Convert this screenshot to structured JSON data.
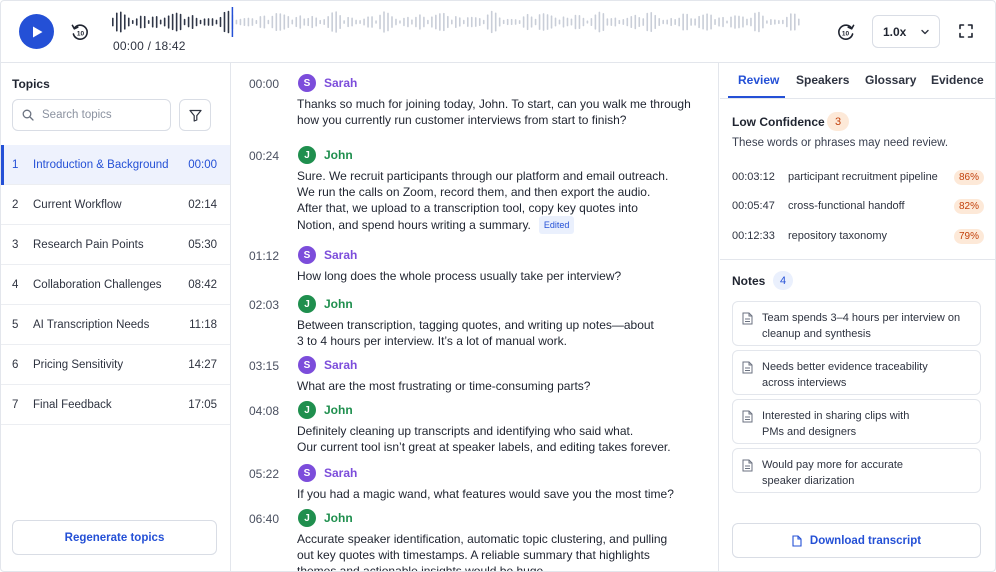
{
  "player": {
    "time_readout": "00:00 / 18:42",
    "rewind_label": "10",
    "forward_label": "10",
    "speed": "1.0x",
    "progress": 0.175,
    "colors": {
      "accent": "#2450d6",
      "wave_played": "#2f3647",
      "wave_unplayed": "#c9ced8"
    }
  },
  "topics": {
    "title": "Topics",
    "search_placeholder": "Search topics",
    "items": [
      {
        "num": "1",
        "label": "Introduction & Background",
        "time": "00:00",
        "active": true
      },
      {
        "num": "2",
        "label": "Current Workflow",
        "time": "02:14"
      },
      {
        "num": "3",
        "label": "Research Pain Points",
        "time": "05:30"
      },
      {
        "num": "4",
        "label": "Collaboration Challenges",
        "time": "08:42"
      },
      {
        "num": "5",
        "label": "AI Transcription Needs",
        "time": "11:18"
      },
      {
        "num": "6",
        "label": "Pricing Sensitivity",
        "time": "14:27"
      },
      {
        "num": "7",
        "label": "Final Feedback",
        "time": "17:05"
      }
    ],
    "regenerate_label": "Regenerate topics"
  },
  "transcript": [
    {
      "time": "00:00",
      "speaker": "Sarah",
      "initial": "S",
      "lines": [
        "Thanks so much for joining today, John. To start, can you walk me through",
        "how you currently run customer interviews from start to finish?"
      ]
    },
    {
      "time": "00:24",
      "speaker": "John",
      "initial": "J",
      "lines": [
        "Sure. We recruit participants through our platform and email outreach.",
        "We run the calls on Zoom, record them, and then export the audio.",
        "After that, we upload to a transcription tool, copy key quotes into",
        "Notion, and spend hours writing a summary."
      ],
      "badge": "Edited"
    },
    {
      "time": "01:12",
      "speaker": "Sarah",
      "initial": "S",
      "lines": [
        "How long does the whole process usually take per interview?"
      ]
    },
    {
      "time": "02:03",
      "speaker": "John",
      "initial": "J",
      "lines": [
        "Between transcription, tagging quotes, and writing up notes—about",
        "3 to 4 hours per interview. It’s a lot of manual work."
      ]
    },
    {
      "time": "03:15",
      "speaker": "Sarah",
      "initial": "S",
      "lines": [
        "What are the most frustrating or time-consuming parts?"
      ]
    },
    {
      "time": "04:08",
      "speaker": "John",
      "initial": "J",
      "lines": [
        "Definitely cleaning up transcripts and identifying who said what.",
        "Our current tool isn’t great at speaker labels, and editing takes forever."
      ]
    },
    {
      "time": "05:22",
      "speaker": "Sarah",
      "initial": "S",
      "lines": [
        "If you had a magic wand, what features would save you the most time?"
      ]
    },
    {
      "time": "06:40",
      "speaker": "John",
      "initial": "J",
      "lines": [
        "Accurate speaker identification, automatic topic clustering, and pulling",
        "out key quotes with timestamps. A reliable summary that highlights",
        "themes and actionable insights would be huge."
      ]
    }
  ],
  "review": {
    "tabs": [
      "Review",
      "Speakers",
      "Glossary",
      "Evidence"
    ],
    "low_confidence": {
      "title": "Low Confidence",
      "count": "3",
      "description": "These words or phrases may need review.",
      "items": [
        {
          "time": "00:03:12",
          "phrase": "participant recruitment pipeline",
          "score": "86%"
        },
        {
          "time": "00:05:47",
          "phrase": "cross-functional handoff",
          "score": "82%"
        },
        {
          "time": "00:12:33",
          "phrase": "repository taxonomy",
          "score": "79%"
        }
      ]
    },
    "notes": {
      "title": "Notes",
      "count": "4",
      "items": [
        {
          "lines": [
            "Team spends 3–4 hours per interview on",
            "cleanup and synthesis"
          ]
        },
        {
          "lines": [
            "Needs better evidence traceability",
            "across interviews"
          ]
        },
        {
          "lines": [
            "Interested in sharing clips with",
            "PMs and designers"
          ]
        },
        {
          "lines": [
            "Would pay more for accurate",
            "speaker diarization"
          ]
        }
      ]
    },
    "download_label": "Download transcript"
  }
}
